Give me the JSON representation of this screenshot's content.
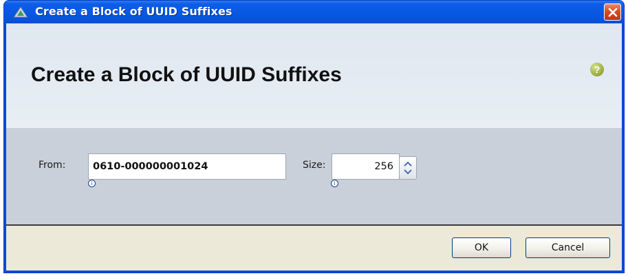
{
  "window": {
    "title": "Create a Block of UUID Suffixes",
    "title_icon": "ucs-manager-icon",
    "close_icon": "close-icon"
  },
  "header": {
    "heading": "Create a Block of UUID Suffixes",
    "help_icon": "help-icon",
    "help_glyph": "?"
  },
  "form": {
    "from_label": "From:",
    "from_value": "0610-000000001024",
    "size_label": "Size:",
    "size_value": "256",
    "required_marker": "i"
  },
  "buttons": {
    "ok": "OK",
    "cancel": "Cancel"
  },
  "colors": {
    "titlebar": "#0757e3",
    "header_bg": "#e4ebf2",
    "form_bg": "#c9d0d9",
    "footer_bg": "#ece9d8",
    "help_icon": "#97a83a",
    "close_button": "#d8491e"
  }
}
